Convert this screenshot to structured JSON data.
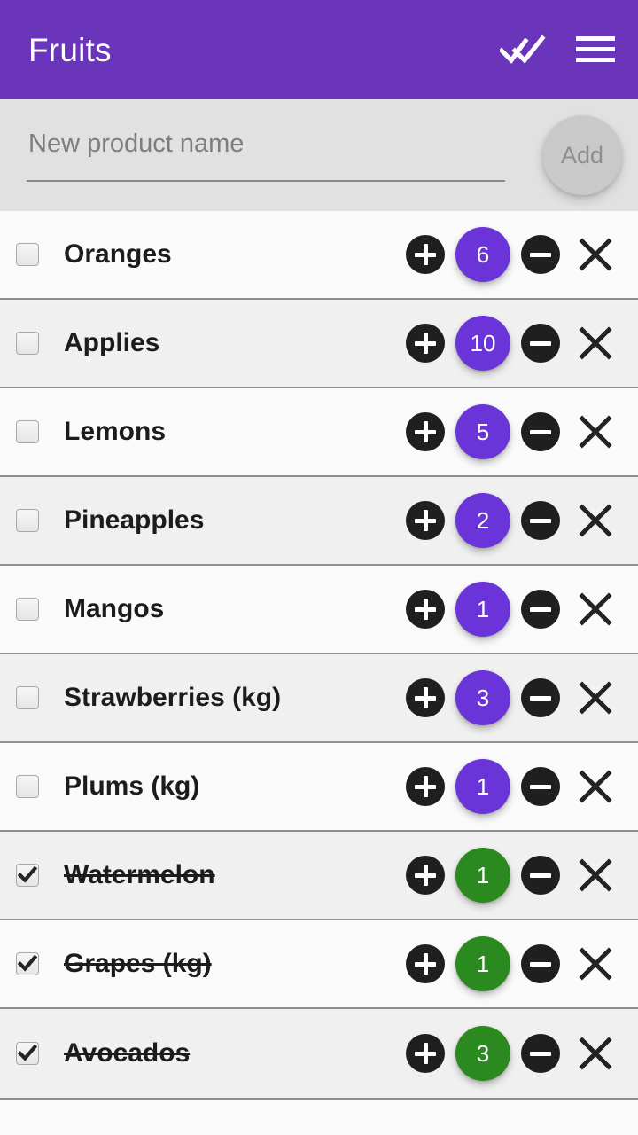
{
  "appbar": {
    "title": "Fruits",
    "check_all_icon": "double-check-icon",
    "menu_icon": "hamburger-menu-icon",
    "accent_color": "#6a34bb"
  },
  "add_form": {
    "input_value": "",
    "input_placeholder": "New product name",
    "add_label": "Add",
    "add_enabled": false,
    "background_color": "#e1e1e1"
  },
  "colors": {
    "badge_pending": "#6a34d8",
    "badge_done": "#2b8a1f",
    "button_dark": "#1f1f1f",
    "row_odd": "#fafafa",
    "row_even": "#f0f0f0",
    "separator": "#8f8f8f"
  },
  "controls": {
    "increment_icon": "plus-circle-icon",
    "decrement_icon": "minus-circle-icon",
    "delete_icon": "close-x-icon",
    "checkbox_icon": "checkbox-icon"
  },
  "list": {
    "items": [
      {
        "name": "Oranges",
        "count": "6",
        "checked": false
      },
      {
        "name": "Applies",
        "count": "10",
        "checked": false
      },
      {
        "name": "Lemons",
        "count": "5",
        "checked": false
      },
      {
        "name": "Pineapples",
        "count": "2",
        "checked": false
      },
      {
        "name": "Mangos",
        "count": "1",
        "checked": false
      },
      {
        "name": "Strawberries (kg)",
        "count": "3",
        "checked": false
      },
      {
        "name": "Plums (kg)",
        "count": "1",
        "checked": false
      },
      {
        "name": "Watermelon",
        "count": "1",
        "checked": true
      },
      {
        "name": "Grapes (kg)",
        "count": "1",
        "checked": true
      },
      {
        "name": "Avocados",
        "count": "3",
        "checked": true
      }
    ]
  }
}
